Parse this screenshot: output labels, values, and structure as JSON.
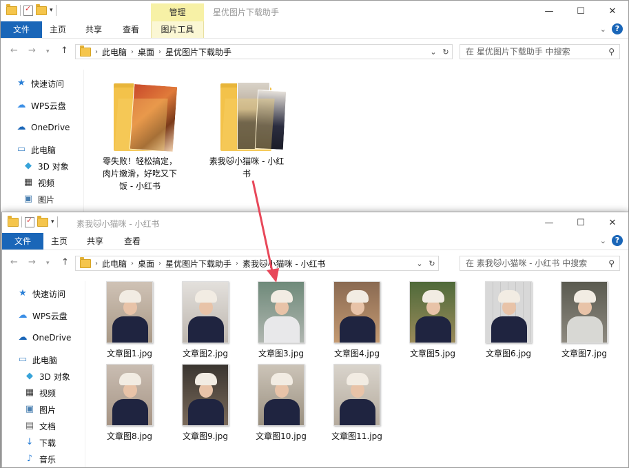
{
  "windows": [
    {
      "id": "back",
      "title": "星优图片下载助手",
      "context_tab_header": "管理",
      "tabs": [
        "文件",
        "主页",
        "共享",
        "查看",
        "图片工具"
      ],
      "breadcrumb": [
        "此电脑",
        "桌面",
        "星优图片下载助手"
      ],
      "search_placeholder": "在 星优图片下载助手 中搜索",
      "nav": [
        {
          "label": "快速访问",
          "icon": "star-icon"
        },
        {
          "label": "WPS云盘",
          "icon": "cloud-icon"
        },
        {
          "label": "OneDrive",
          "icon": "onedrive-icon"
        },
        {
          "label": "此电脑",
          "icon": "pc-icon"
        },
        {
          "label": "3D 对象",
          "icon": "cube-icon"
        },
        {
          "label": "视频",
          "icon": "video-icon"
        },
        {
          "label": "图片",
          "icon": "picture-icon"
        }
      ],
      "folders": [
        {
          "name": "零失败！轻松搞定，肉片嫩滑，好吃又下饭 - 小红书"
        },
        {
          "name": "素我🐱小猫咪 - 小红书"
        }
      ]
    },
    {
      "id": "front",
      "title": "素我🐱小猫咪 - 小红书",
      "tabs": [
        "文件",
        "主页",
        "共享",
        "查看"
      ],
      "breadcrumb": [
        "此电脑",
        "桌面",
        "星优图片下载助手",
        "素我🐱小猫咪 - 小红书"
      ],
      "search_placeholder": "在 素我🐱小猫咪 - 小红书 中搜索",
      "nav": [
        {
          "label": "快速访问",
          "icon": "star-icon"
        },
        {
          "label": "WPS云盘",
          "icon": "cloud-icon"
        },
        {
          "label": "OneDrive",
          "icon": "onedrive-icon"
        },
        {
          "label": "此电脑",
          "icon": "pc-icon"
        },
        {
          "label": "3D 对象",
          "icon": "cube-icon"
        },
        {
          "label": "视频",
          "icon": "video-icon"
        },
        {
          "label": "图片",
          "icon": "picture-icon"
        },
        {
          "label": "文档",
          "icon": "document-icon"
        },
        {
          "label": "下载",
          "icon": "download-icon"
        },
        {
          "label": "音乐",
          "icon": "music-icon"
        }
      ],
      "files": [
        "文章图1.jpg",
        "文章图2.jpg",
        "文章图3.jpg",
        "文章图4.jpg",
        "文章图5.jpg",
        "文章图6.jpg",
        "文章图7.jpg",
        "文章图8.jpg",
        "文章图9.jpg",
        "文章图10.jpg",
        "文章图11.jpg"
      ]
    }
  ],
  "colors": {
    "file_tab": "#1a66b8",
    "context_tab": "#f7f1a6",
    "arrow": "#e8485a",
    "folder": "#f3c24a"
  }
}
